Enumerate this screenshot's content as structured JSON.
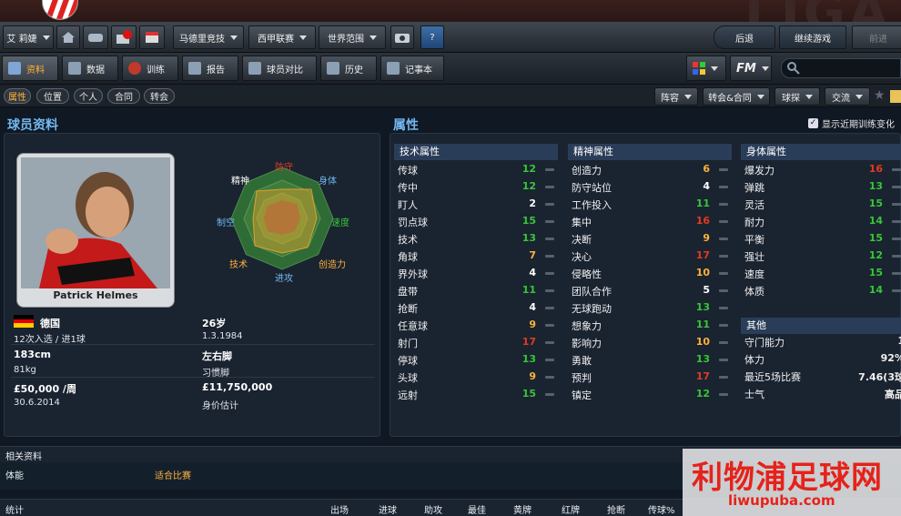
{
  "nav": {
    "player_name": "艾 莉婕",
    "club1": "马德里竞技",
    "league": "西甲联赛",
    "world": "世界范围",
    "help": "?",
    "back": "后退",
    "continue": "继续游戏",
    "forward": "前进"
  },
  "tabs": [
    "资料",
    "数据",
    "训练",
    "报告",
    "球员对比",
    "历史",
    "记事本"
  ],
  "subtabs": [
    "属性",
    "位置",
    "个人",
    "合同",
    "转会"
  ],
  "right_tools": {
    "fm": "FM",
    "squad": "阵容",
    "transfer": "转会&合同",
    "scout": "球探",
    "exchange": "交流"
  },
  "profile": {
    "section_title": "球员资料",
    "player_name": "Patrick Helmes",
    "nationality": "德国",
    "caps": "12次入选 / 进1球",
    "age": "26岁",
    "birth": "1.3.1984",
    "height": "183cm",
    "weight": "81kg",
    "foot": "左右脚",
    "foot_label": "习惯脚",
    "wage": "£50,000 /周",
    "value": "£11,750,000",
    "value_label": "身价估计",
    "contract": "30.6.2014"
  },
  "radar": {
    "labels": {
      "defense": "防守",
      "physical": "身体",
      "speed": "速度",
      "creativity": "创造力",
      "attack": "进攻",
      "technique": "技术",
      "aerial": "制空",
      "mental": "精神"
    }
  },
  "attributes": {
    "section_title": "属性",
    "show_changes": "显示近期训练变化",
    "technical_title": "技术属性",
    "mental_title": "精神属性",
    "physical_title": "身体属性",
    "other_title": "其他",
    "technical": [
      {
        "n": "传球",
        "v": "12"
      },
      {
        "n": "传中",
        "v": "12"
      },
      {
        "n": "盯人",
        "v": "2"
      },
      {
        "n": "罚点球",
        "v": "15"
      },
      {
        "n": "技术",
        "v": "13"
      },
      {
        "n": "角球",
        "v": "7"
      },
      {
        "n": "界外球",
        "v": "4"
      },
      {
        "n": "盘带",
        "v": "11"
      },
      {
        "n": "抢断",
        "v": "4"
      },
      {
        "n": "任意球",
        "v": "9"
      },
      {
        "n": "射门",
        "v": "17"
      },
      {
        "n": "停球",
        "v": "13"
      },
      {
        "n": "头球",
        "v": "9"
      },
      {
        "n": "远射",
        "v": "15"
      }
    ],
    "mental": [
      {
        "n": "创造力",
        "v": "6"
      },
      {
        "n": "防守站位",
        "v": "4"
      },
      {
        "n": "工作投入",
        "v": "11"
      },
      {
        "n": "集中",
        "v": "16"
      },
      {
        "n": "决断",
        "v": "9"
      },
      {
        "n": "决心",
        "v": "17"
      },
      {
        "n": "侵略性",
        "v": "10"
      },
      {
        "n": "团队合作",
        "v": "5"
      },
      {
        "n": "无球跑动",
        "v": "13"
      },
      {
        "n": "想象力",
        "v": "11"
      },
      {
        "n": "影响力",
        "v": "10"
      },
      {
        "n": "勇敢",
        "v": "13"
      },
      {
        "n": "预判",
        "v": "17"
      },
      {
        "n": "镇定",
        "v": "12"
      }
    ],
    "physical": [
      {
        "n": "爆发力",
        "v": "16"
      },
      {
        "n": "弹跳",
        "v": "13"
      },
      {
        "n": "灵活",
        "v": "15"
      },
      {
        "n": "耐力",
        "v": "14"
      },
      {
        "n": "平衡",
        "v": "15"
      },
      {
        "n": "强壮",
        "v": "12"
      },
      {
        "n": "速度",
        "v": "15"
      },
      {
        "n": "体质",
        "v": "14"
      }
    ],
    "other": [
      {
        "n": "守门能力",
        "v": "1"
      },
      {
        "n": "体力",
        "v": "92%"
      },
      {
        "n": "最近5场比赛",
        "v": "7.46(3球"
      },
      {
        "n": "士气",
        "v": "高品"
      }
    ]
  },
  "bottom": {
    "related": "相关资料",
    "fitness": "体能",
    "fitness_val": "适合比赛",
    "stats": "统计",
    "cols": [
      "出场",
      "进球",
      "助攻",
      "最佳",
      "黄牌",
      "红牌",
      "抢断",
      "传球%"
    ]
  },
  "watermark": {
    "line1": "利物浦足球网",
    "line2": "liwupuba.com"
  },
  "colors": {
    "orange": "#ffb23c",
    "green": "#37c737",
    "red": "#e23a22",
    "white": "#ffffff",
    "accent_blue": "#72b8f0"
  }
}
